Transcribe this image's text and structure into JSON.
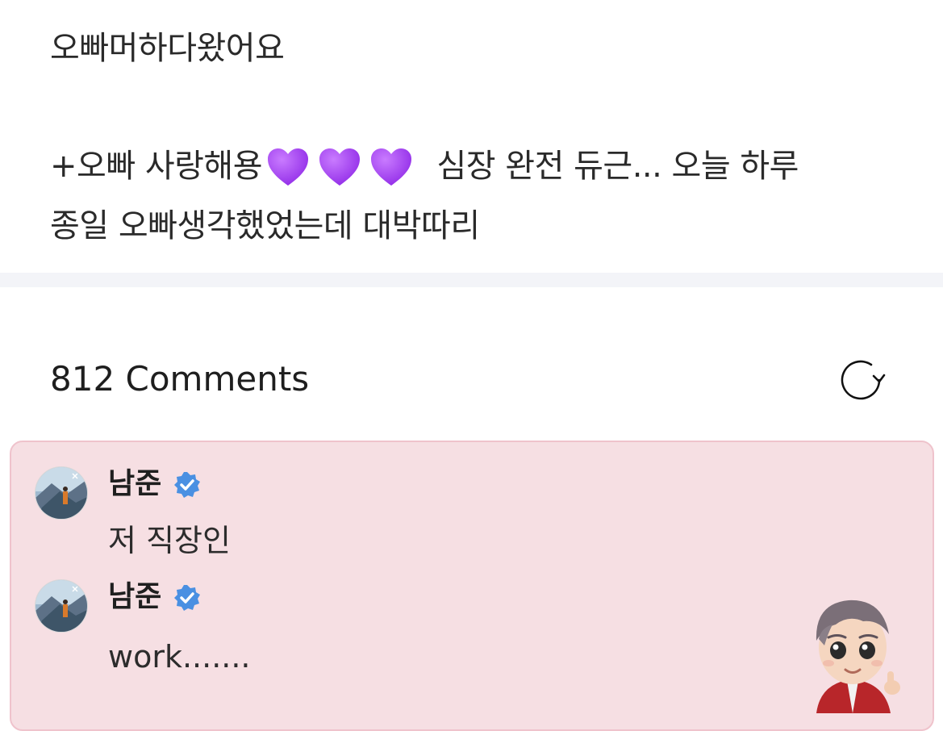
{
  "post": {
    "line1": "오빠머하다왔어요",
    "line2_before_hearts": "+오빠 사랑해용",
    "line2_after_hearts": "심장 완전 듀근... 오늘 하루",
    "line3": "종일 오빠생각했었는데 대박따리",
    "heart_icon": "purple-heart-emoji",
    "heart_color": "#a23ff2"
  },
  "comments": {
    "count_label": "812 Comments",
    "refresh_icon": "refresh-icon",
    "highlight_bg": "#f6dfe3",
    "items": [
      {
        "username": "남준",
        "verified": true,
        "text": "저 직장인"
      },
      {
        "username": "남준",
        "verified": true,
        "text": "work......."
      }
    ],
    "sticker_icon": "cartoon-character-sticker"
  },
  "colors": {
    "verified_badge": "#4a90e2",
    "divider": "#f3f4f8"
  }
}
